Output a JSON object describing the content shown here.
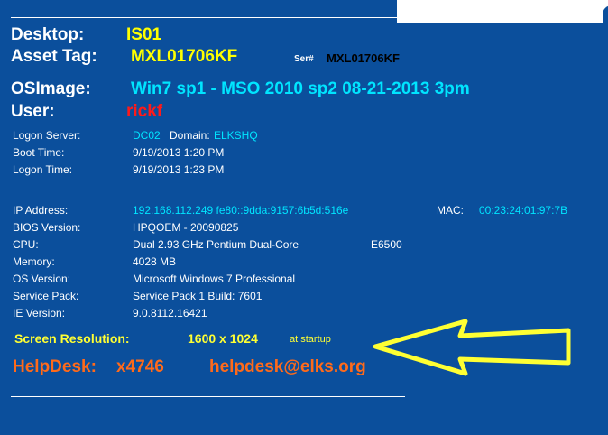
{
  "desktop": {
    "label": "Desktop:",
    "value": "IS01"
  },
  "asset_tag": {
    "label": "Asset Tag:",
    "value": "MXL01706KF",
    "serial_label": "Ser#",
    "serial_value": "MXL01706KF"
  },
  "os_image": {
    "label": "OSImage:",
    "value": "Win7 sp1 - MSO 2010 sp2 08-21-2013 3pm"
  },
  "user": {
    "label": "User:",
    "value": "rickf"
  },
  "logon_server": {
    "label": "Logon Server:",
    "value": "DC02",
    "domain_label": "Domain:",
    "domain_value": "ELKSHQ"
  },
  "boot_time": {
    "label": "Boot Time:",
    "value": "9/19/2013 1:20 PM"
  },
  "logon_time": {
    "label": "Logon Time:",
    "value": "9/19/2013 1:23 PM"
  },
  "ip_address": {
    "label": "IP Address:",
    "value": "192.168.112.249 fe80::9dda:9157:6b5d:516e",
    "mac_label": "MAC:",
    "mac_value": "00:23:24:01:97:7B"
  },
  "bios_version": {
    "label": "BIOS Version:",
    "value": "HPQOEM - 20090825"
  },
  "cpu": {
    "label": "CPU:",
    "value": "Dual 2.93 GHz Pentium Dual-Core",
    "model": "E6500"
  },
  "memory": {
    "label": "Memory:",
    "value": "4028 MB"
  },
  "os_version": {
    "label": "OS Version:",
    "value": "Microsoft Windows 7 Professional"
  },
  "service_pack": {
    "label": "Service Pack:",
    "value": "Service Pack 1 Build: 7601"
  },
  "ie_version": {
    "label": "IE Version:",
    "value": "9.0.8112.16421"
  },
  "screen_resolution": {
    "label": "Screen Resolution:",
    "value": "1600 x 1024",
    "note": "at startup"
  },
  "helpdesk": {
    "label": "HelpDesk:",
    "ext": "x4746",
    "email": "helpdesk@elks.org"
  },
  "colors": {
    "background": "#0b4f9c",
    "yellow": "#ffff00",
    "cyan": "#00e5ff",
    "red": "#ff1a1a",
    "orange": "#ff6a1a",
    "arrow": "#ffff33"
  },
  "icons": {
    "arrow": "arrow-left-icon"
  }
}
